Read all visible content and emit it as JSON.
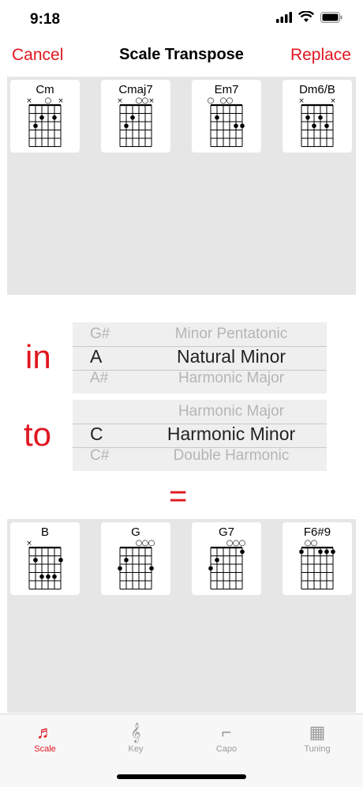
{
  "status": {
    "time": "9:18"
  },
  "nav": {
    "cancel": "Cancel",
    "title": "Scale Transpose",
    "replace": "Replace"
  },
  "source_chords": [
    {
      "name": "Cm",
      "markers": [
        "x",
        "",
        "",
        "o",
        "",
        "x"
      ],
      "dots": [
        [
          1,
          3
        ],
        [
          2,
          2
        ],
        [
          4,
          2
        ]
      ]
    },
    {
      "name": "Cmaj7",
      "markers": [
        "x",
        "",
        "",
        "o",
        "o",
        "x"
      ],
      "dots": [
        [
          1,
          3
        ],
        [
          2,
          2
        ]
      ]
    },
    {
      "name": "Em7",
      "markers": [
        "o",
        "",
        "o",
        "o",
        "",
        ""
      ],
      "dots": [
        [
          1,
          2
        ],
        [
          4,
          3
        ],
        [
          5,
          3
        ]
      ]
    },
    {
      "name": "Dm6/B",
      "markers": [
        "x",
        "",
        "",
        "",
        "",
        "x"
      ],
      "dots": [
        [
          1,
          2
        ],
        [
          2,
          3
        ],
        [
          3,
          2
        ],
        [
          4,
          3
        ]
      ]
    }
  ],
  "in_label": "in",
  "to_label": "to",
  "picker_in": {
    "above_note": "G#",
    "above_scale": "Minor Pentatonic",
    "note": "A",
    "scale": "Natural Minor",
    "below_note": "A#",
    "below_scale": "Harmonic Major"
  },
  "picker_to": {
    "above_note": "",
    "above_scale": "Harmonic Major",
    "note": "C",
    "scale": "Harmonic Minor",
    "below_note": "C#",
    "below_scale": "Double Harmonic"
  },
  "equals": "=",
  "result_chords": [
    {
      "name": "B",
      "markers": [
        "x",
        "",
        "",
        "",
        "",
        ""
      ],
      "dots": [
        [
          1,
          2
        ],
        [
          2,
          4
        ],
        [
          3,
          4
        ],
        [
          4,
          4
        ],
        [
          5,
          2
        ]
      ]
    },
    {
      "name": "G",
      "markers": [
        "",
        "",
        "",
        "o",
        "o",
        "o"
      ],
      "dots": [
        [
          0,
          3
        ],
        [
          1,
          2
        ],
        [
          5,
          3
        ]
      ]
    },
    {
      "name": "G7",
      "markers": [
        "",
        "",
        "",
        "o",
        "o",
        "o"
      ],
      "dots": [
        [
          0,
          3
        ],
        [
          1,
          2
        ],
        [
          5,
          1
        ]
      ]
    },
    {
      "name": "F6#9",
      "markers": [
        "",
        "o",
        "o",
        "",
        "",
        ""
      ],
      "dots": [
        [
          0,
          1
        ],
        [
          3,
          1
        ],
        [
          4,
          1
        ],
        [
          5,
          1
        ]
      ]
    }
  ],
  "tabs": [
    {
      "label": "Scale",
      "icon": "music-notes-icon",
      "glyph": "♬",
      "active": true
    },
    {
      "label": "Key",
      "icon": "treble-clef-icon",
      "glyph": "𝄞",
      "active": false
    },
    {
      "label": "Capo",
      "icon": "capo-icon",
      "glyph": "⌐",
      "active": false
    },
    {
      "label": "Tuning",
      "icon": "tuning-peg-icon",
      "glyph": "▦",
      "active": false
    }
  ],
  "colors": {
    "accent": "#e0161f",
    "panel": "#e6e6e6"
  }
}
